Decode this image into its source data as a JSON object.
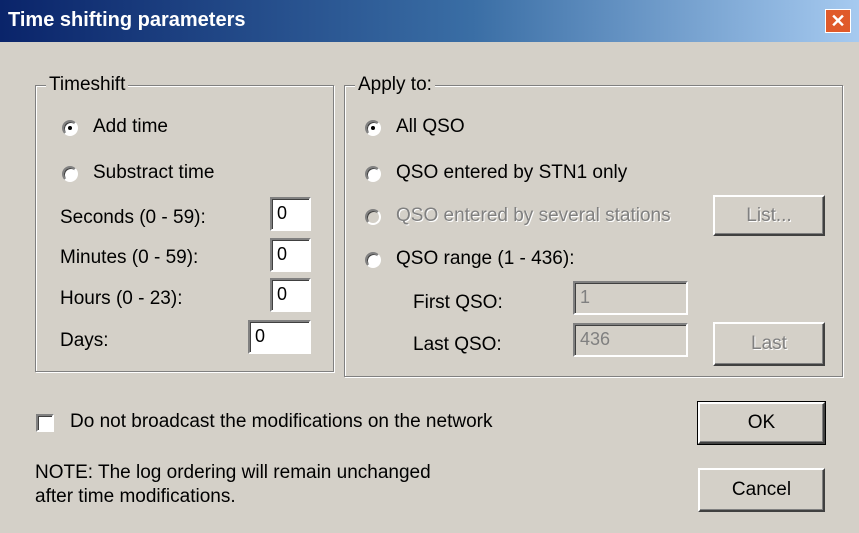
{
  "window": {
    "title": "Time shifting parameters",
    "close_glyph": "✕"
  },
  "timeshift": {
    "group_label": "Timeshift",
    "add_time": "Add time",
    "subtract_time": "Substract time",
    "selected": "add_time",
    "seconds_label": "Seconds (0 - 59):",
    "seconds_value": "0",
    "minutes_label": "Minutes (0 - 59):",
    "minutes_value": "0",
    "hours_label": "Hours (0 - 23):",
    "hours_value": "0",
    "days_label": "Days:",
    "days_value": "0"
  },
  "apply_to": {
    "group_label": "Apply to:",
    "all_qso": "All QSO",
    "stn1_only": "QSO entered by STN1 only",
    "several_stations": "QSO entered by several stations",
    "qso_range": "QSO range (1 - 436):",
    "selected": "all_qso",
    "list_button": "List...",
    "first_qso_label": "First QSO:",
    "first_qso_value": "1",
    "last_qso_label": "Last QSO:",
    "last_qso_value": "436",
    "last_button": "Last"
  },
  "broadcast_checkbox": {
    "label": "Do not broadcast the modifications on the network",
    "checked": false
  },
  "note": {
    "line1": "NOTE: The log ordering will remain unchanged",
    "line2": "after time modifications."
  },
  "buttons": {
    "ok": "OK",
    "cancel": "Cancel"
  }
}
